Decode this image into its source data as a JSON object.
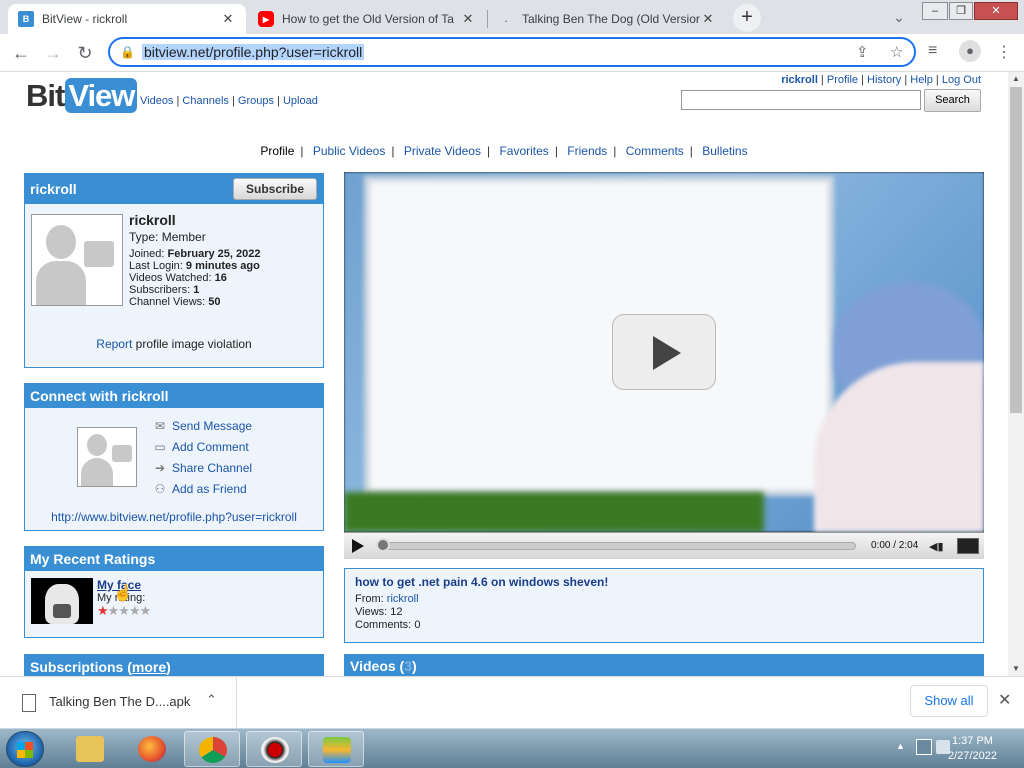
{
  "browser": {
    "tabs": [
      {
        "title": "BitView - rickroll",
        "favicon": "bitview-icon"
      },
      {
        "title": "How to get the Old Version of Ta",
        "favicon": "youtube-icon"
      },
      {
        "title": "Talking Ben The Dog (Old Versior",
        "favicon": "loading-icon"
      }
    ],
    "url": "bitview.net/profile.php?user=rickroll"
  },
  "site": {
    "logo_bit": "Bit",
    "logo_view": "View",
    "nav": [
      "Videos",
      "Channels",
      "Groups",
      "Upload"
    ],
    "user_links": {
      "user": "rickroll",
      "items": [
        "Profile",
        "History",
        "Help",
        "Log Out"
      ]
    },
    "search_button": "Search"
  },
  "profile_tabs": [
    "Profile",
    "Public Videos",
    "Private Videos",
    "Favorites",
    "Friends",
    "Comments",
    "Bulletins"
  ],
  "profile_box": {
    "header": "rickroll",
    "subscribe": "Subscribe",
    "name": "rickroll",
    "type_label": "Type:",
    "type_value": "Member",
    "joined_label": "Joined:",
    "joined_value": "February 25, 2022",
    "login_label": "Last Login:",
    "login_value": "9 minutes ago",
    "watched_label": "Videos Watched:",
    "watched_value": "16",
    "subs_label": "Subscribers:",
    "subs_value": "1",
    "views_label": "Channel Views:",
    "views_value": "50",
    "report_link": "Report",
    "report_text": " profile image violation"
  },
  "connect_box": {
    "header": "Connect with rickroll",
    "items": [
      "Send Message",
      "Add Comment",
      "Share Channel",
      "Add as Friend"
    ],
    "url": "http://www.bitview.net/profile.php?user=rickroll"
  },
  "ratings_box": {
    "header": "My Recent Ratings",
    "video_title": "My face",
    "rating_label": "My rating:",
    "stars": 1,
    "stars_max": 5
  },
  "subscriptions": {
    "header": "Subscriptions (",
    "more": "more",
    "close": ")"
  },
  "player": {
    "time": "0:00 / 2:04"
  },
  "video_info": {
    "title": "how to get .net pain 4.6 on windows sheven!",
    "from_label": "From:",
    "from_value": "rickroll",
    "views_label": "Views:",
    "views_value": "12",
    "comments_label": "Comments:",
    "comments_value": "0"
  },
  "videos_bar": {
    "label": "Videos (",
    "count": "3",
    "close": ")"
  },
  "download": {
    "filename": "Talking Ben The D....apk",
    "show_all": "Show all"
  },
  "taskbar": {
    "time": "1:37 PM",
    "date": "2/27/2022"
  },
  "colors": {
    "accent": "#3a8fd4",
    "link": "#1a55a8",
    "chrome_blue": "#1a73e8"
  }
}
